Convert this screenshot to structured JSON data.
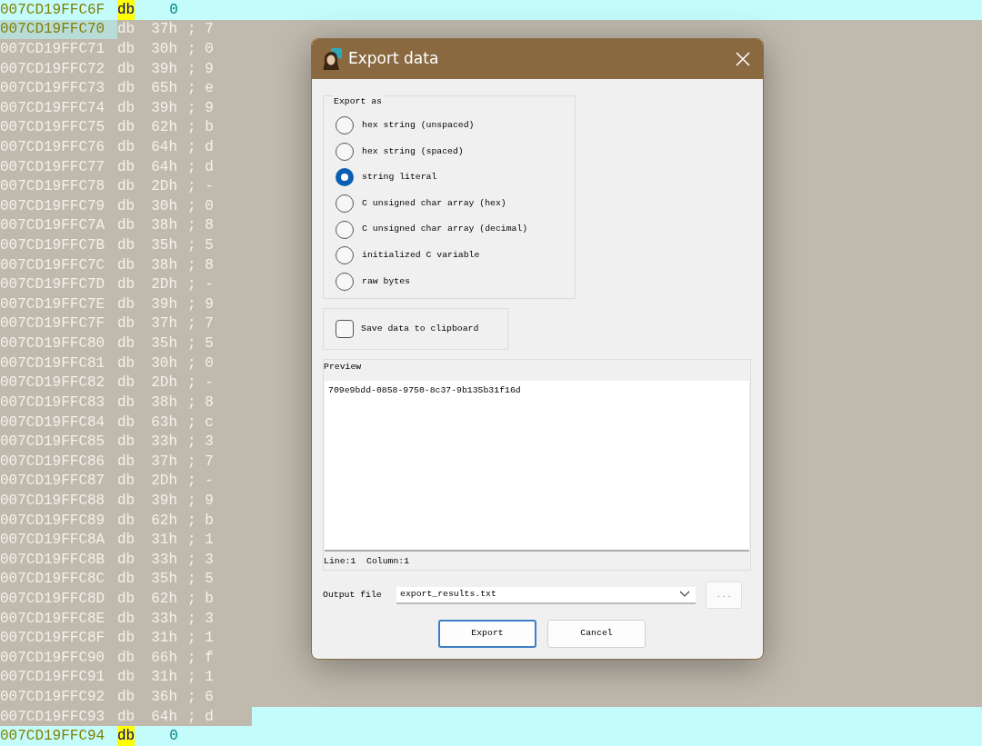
{
  "listing": [
    {
      "address": "007CD19FFC6F",
      "mnemonic": "db",
      "operand": "0",
      "kind": "plain",
      "cursor": false,
      "highlight": true
    },
    {
      "address": "007CD19FFC70",
      "mnemonic": "db",
      "operand": "37h",
      "comment": "; 7",
      "kind": "selected",
      "cursor": true,
      "highlight": false
    },
    {
      "address": "007CD19FFC71",
      "mnemonic": "db",
      "operand": "30h",
      "comment": "; 0",
      "kind": "selected",
      "cursor": false,
      "highlight": false
    },
    {
      "address": "007CD19FFC72",
      "mnemonic": "db",
      "operand": "39h",
      "comment": "; 9",
      "kind": "selected",
      "cursor": false,
      "highlight": false
    },
    {
      "address": "007CD19FFC73",
      "mnemonic": "db",
      "operand": "65h",
      "comment": "; e",
      "kind": "selected",
      "cursor": false,
      "highlight": false
    },
    {
      "address": "007CD19FFC74",
      "mnemonic": "db",
      "operand": "39h",
      "comment": "; 9",
      "kind": "selected",
      "cursor": false,
      "highlight": false
    },
    {
      "address": "007CD19FFC75",
      "mnemonic": "db",
      "operand": "62h",
      "comment": "; b",
      "kind": "selected",
      "cursor": false,
      "highlight": false
    },
    {
      "address": "007CD19FFC76",
      "mnemonic": "db",
      "operand": "64h",
      "comment": "; d",
      "kind": "selected",
      "cursor": false,
      "highlight": false
    },
    {
      "address": "007CD19FFC77",
      "mnemonic": "db",
      "operand": "64h",
      "comment": "; d",
      "kind": "selected",
      "cursor": false,
      "highlight": false
    },
    {
      "address": "007CD19FFC78",
      "mnemonic": "db",
      "operand": "2Dh",
      "comment": "; -",
      "kind": "selected",
      "cursor": false,
      "highlight": false
    },
    {
      "address": "007CD19FFC79",
      "mnemonic": "db",
      "operand": "30h",
      "comment": "; 0",
      "kind": "selected",
      "cursor": false,
      "highlight": false
    },
    {
      "address": "007CD19FFC7A",
      "mnemonic": "db",
      "operand": "38h",
      "comment": "; 8",
      "kind": "selected",
      "cursor": false,
      "highlight": false
    },
    {
      "address": "007CD19FFC7B",
      "mnemonic": "db",
      "operand": "35h",
      "comment": "; 5",
      "kind": "selected",
      "cursor": false,
      "highlight": false
    },
    {
      "address": "007CD19FFC7C",
      "mnemonic": "db",
      "operand": "38h",
      "comment": "; 8",
      "kind": "selected",
      "cursor": false,
      "highlight": false
    },
    {
      "address": "007CD19FFC7D",
      "mnemonic": "db",
      "operand": "2Dh",
      "comment": "; -",
      "kind": "selected",
      "cursor": false,
      "highlight": false
    },
    {
      "address": "007CD19FFC7E",
      "mnemonic": "db",
      "operand": "39h",
      "comment": "; 9",
      "kind": "selected",
      "cursor": false,
      "highlight": false
    },
    {
      "address": "007CD19FFC7F",
      "mnemonic": "db",
      "operand": "37h",
      "comment": "; 7",
      "kind": "selected",
      "cursor": false,
      "highlight": false
    },
    {
      "address": "007CD19FFC80",
      "mnemonic": "db",
      "operand": "35h",
      "comment": "; 5",
      "kind": "selected",
      "cursor": false,
      "highlight": false
    },
    {
      "address": "007CD19FFC81",
      "mnemonic": "db",
      "operand": "30h",
      "comment": "; 0",
      "kind": "selected",
      "cursor": false,
      "highlight": false
    },
    {
      "address": "007CD19FFC82",
      "mnemonic": "db",
      "operand": "2Dh",
      "comment": "; -",
      "kind": "selected",
      "cursor": false,
      "highlight": false
    },
    {
      "address": "007CD19FFC83",
      "mnemonic": "db",
      "operand": "38h",
      "comment": "; 8",
      "kind": "selected",
      "cursor": false,
      "highlight": false
    },
    {
      "address": "007CD19FFC84",
      "mnemonic": "db",
      "operand": "63h",
      "comment": "; c",
      "kind": "selected",
      "cursor": false,
      "highlight": false
    },
    {
      "address": "007CD19FFC85",
      "mnemonic": "db",
      "operand": "33h",
      "comment": "; 3",
      "kind": "selected",
      "cursor": false,
      "highlight": false
    },
    {
      "address": "007CD19FFC86",
      "mnemonic": "db",
      "operand": "37h",
      "comment": "; 7",
      "kind": "selected",
      "cursor": false,
      "highlight": false
    },
    {
      "address": "007CD19FFC87",
      "mnemonic": "db",
      "operand": "2Dh",
      "comment": "; -",
      "kind": "selected",
      "cursor": false,
      "highlight": false
    },
    {
      "address": "007CD19FFC88",
      "mnemonic": "db",
      "operand": "39h",
      "comment": "; 9",
      "kind": "selected",
      "cursor": false,
      "highlight": false
    },
    {
      "address": "007CD19FFC89",
      "mnemonic": "db",
      "operand": "62h",
      "comment": "; b",
      "kind": "selected",
      "cursor": false,
      "highlight": false
    },
    {
      "address": "007CD19FFC8A",
      "mnemonic": "db",
      "operand": "31h",
      "comment": "; 1",
      "kind": "selected",
      "cursor": false,
      "highlight": false
    },
    {
      "address": "007CD19FFC8B",
      "mnemonic": "db",
      "operand": "33h",
      "comment": "; 3",
      "kind": "selected",
      "cursor": false,
      "highlight": false
    },
    {
      "address": "007CD19FFC8C",
      "mnemonic": "db",
      "operand": "35h",
      "comment": "; 5",
      "kind": "selected",
      "cursor": false,
      "highlight": false
    },
    {
      "address": "007CD19FFC8D",
      "mnemonic": "db",
      "operand": "62h",
      "comment": "; b",
      "kind": "selected",
      "cursor": false,
      "highlight": false
    },
    {
      "address": "007CD19FFC8E",
      "mnemonic": "db",
      "operand": "33h",
      "comment": "; 3",
      "kind": "selected",
      "cursor": false,
      "highlight": false
    },
    {
      "address": "007CD19FFC8F",
      "mnemonic": "db",
      "operand": "31h",
      "comment": "; 1",
      "kind": "selected",
      "cursor": false,
      "highlight": false
    },
    {
      "address": "007CD19FFC90",
      "mnemonic": "db",
      "operand": "66h",
      "comment": "; f",
      "kind": "selected",
      "cursor": false,
      "highlight": false
    },
    {
      "address": "007CD19FFC91",
      "mnemonic": "db",
      "operand": "31h",
      "comment": "; 1",
      "kind": "selected",
      "cursor": false,
      "highlight": false
    },
    {
      "address": "007CD19FFC92",
      "mnemonic": "db",
      "operand": "36h",
      "comment": "; 6",
      "kind": "selected",
      "cursor": false,
      "highlight": false
    },
    {
      "address": "007CD19FFC93",
      "mnemonic": "db",
      "operand": "64h",
      "comment": "; d",
      "kind": "selection-end",
      "cursor": false,
      "highlight": false
    },
    {
      "address": "007CD19FFC94",
      "mnemonic": "db",
      "operand": "0",
      "kind": "plain",
      "cursor": false,
      "highlight": true
    }
  ],
  "dialog": {
    "title": "Export data",
    "export_as": {
      "label": "Export as",
      "options": [
        {
          "label": "hex string (unspaced)",
          "selected": false
        },
        {
          "label": "hex string (spaced)",
          "selected": false
        },
        {
          "label": "string literal",
          "selected": true
        },
        {
          "label": "C unsigned char array (hex)",
          "selected": false
        },
        {
          "label": "C unsigned char array (decimal)",
          "selected": false
        },
        {
          "label": "initialized C variable",
          "selected": false
        },
        {
          "label": "raw bytes",
          "selected": false
        }
      ]
    },
    "clipboard": {
      "label": "Save data to clipboard",
      "checked": false
    },
    "preview": {
      "label": "Preview",
      "value": "709e9bdd-0858-9750-8c37-9b135b31f16d",
      "status": "Line:1  Column:1"
    },
    "output_file": {
      "label": "Output file",
      "value": "export_results.txt",
      "browse": "..."
    },
    "buttons": [
      {
        "label": "Export",
        "default": true
      },
      {
        "label": "Cancel",
        "default": false
      }
    ]
  }
}
